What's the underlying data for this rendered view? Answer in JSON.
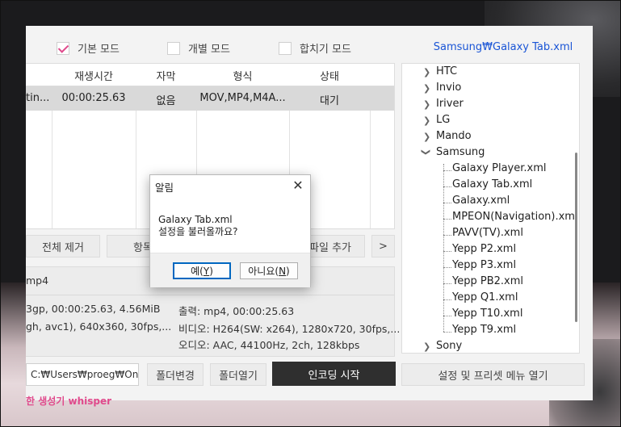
{
  "modes": [
    {
      "label": "기본 모드",
      "checked": true
    },
    {
      "label": "개별 모드",
      "checked": false
    },
    {
      "label": "합치기 모드",
      "checked": false
    }
  ],
  "preset_path": "Samsung₩Galaxy Tab.xml",
  "table": {
    "headers": [
      "재생시간",
      "자막",
      "형식",
      "상태"
    ],
    "row": {
      "name": "tin...",
      "duration": "00:00:25.63",
      "subtitle": "없음",
      "format": "MOV,MP4,M4A...",
      "status": "대기"
    }
  },
  "buttons": {
    "remove_all": "전체 제거",
    "item": "항목",
    "add_file": "파일 추가",
    "more": ">"
  },
  "info": {
    "filename": "mp4",
    "in_line1": "3gp, 00:00:25.63, 4.56MiB",
    "in_line2": "gh, avc1), 640x360, 30fps,...",
    "out_line1": "출력: mp4, 00:00:25.63",
    "out_line2": "비디오: H264(SW: x264), 1280x720, 30fps,...",
    "out_line3": "오디오: AAC, 44100Hz, 2ch, 128kbps"
  },
  "bottom": {
    "path": "C:₩Users₩proeg₩One",
    "folder_change": "폴더변경",
    "folder_open": "폴더열기",
    "start": "인코딩 시작",
    "settings": "설정 및 프리셋 메뉴 열기",
    "stripe": "한 생성기 whisper"
  },
  "tree": {
    "brands": [
      "HTC",
      "Invio",
      "Iriver",
      "LG",
      "Mando",
      "Samsung"
    ],
    "samsung_children": [
      "Galaxy Player.xml",
      "Galaxy Tab.xml",
      "Galaxy.xml",
      "MPEON(Navigation).xml",
      "PAVV(TV).xml",
      "Yepp P2.xml",
      "Yepp P3.xml",
      "Yepp PB2.xml",
      "Yepp Q1.xml",
      "Yepp T10.xml",
      "Yepp T9.xml"
    ],
    "after": "Sony"
  },
  "dialog": {
    "title": "알림",
    "line1": "Galaxy Tab.xml",
    "line2": "설정을 불러올까요?",
    "yes": "예",
    "yes_key": "Y",
    "no": "아니요",
    "no_key": "N"
  }
}
